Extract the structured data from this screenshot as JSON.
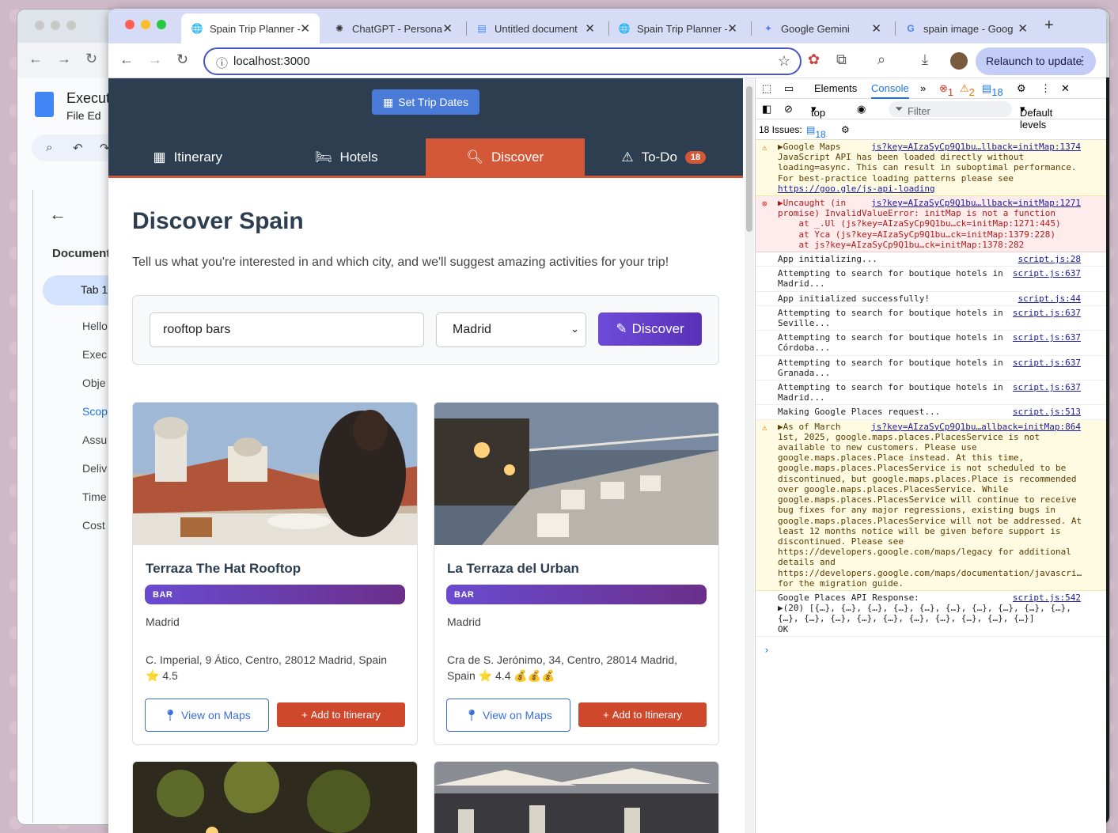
{
  "back_window": {
    "doc_title": "Execut",
    "menu": "File   Ed",
    "outline_heading": "Document",
    "outline_tab": "Tab 1",
    "outline_items": [
      "Hello",
      "Exec",
      "Obje",
      "Scop",
      "Assu",
      "Deliv",
      "Time",
      "Cost"
    ]
  },
  "browser": {
    "tabs": [
      {
        "title": "Spain Trip Planner -",
        "icon": "globe-icon",
        "active": true
      },
      {
        "title": "ChatGPT - Persona",
        "icon": "chatgpt-icon",
        "active": false
      },
      {
        "title": "Untitled document",
        "icon": "docs-icon",
        "active": false
      },
      {
        "title": "Spain Trip Planner -",
        "icon": "globe-icon",
        "active": false
      },
      {
        "title": "Google Gemini",
        "icon": "gemini-icon",
        "active": false
      },
      {
        "title": "spain image - Goog",
        "icon": "google-icon",
        "active": false
      }
    ],
    "url": "localhost:3000",
    "relaunch": "Relaunch to update"
  },
  "app": {
    "trip_dates": "Set Trip Dates",
    "nav": [
      {
        "label": "Itinerary",
        "icon": "calendar-icon"
      },
      {
        "label": "Hotels",
        "icon": "bed-icon"
      },
      {
        "label": "Discover",
        "icon": "search-icon"
      },
      {
        "label": "To-Do",
        "icon": "warning-icon",
        "badge": "18"
      }
    ],
    "title": "Discover Spain",
    "lead": "Tell us what you're interested in and which city, and we'll suggest amazing activities for your trip!",
    "search": {
      "value": "rooftop bars",
      "city": "Madrid",
      "button": "Discover"
    },
    "cards": [
      {
        "title": "Terraza The Hat Rooftop",
        "badge": "BAR",
        "city": "Madrid",
        "address": "C. Imperial, 9 Ático, Centro, 28012 Madrid, Spain",
        "rating": "⭐ 4.5",
        "view": "View on Maps",
        "add": "Add to Itinerary"
      },
      {
        "title": "La Terraza del Urban",
        "badge": "BAR",
        "city": "Madrid",
        "address": "Cra de S. Jerónimo, 34, Centro, 28014 Madrid, Spain",
        "rating": "⭐ 4.4 💰💰💰",
        "view": "View on Maps",
        "add": "Add to Itinerary"
      }
    ]
  },
  "devtools": {
    "tabs": {
      "elements": "Elements",
      "console": "Console",
      "more": "»"
    },
    "counts": {
      "errors": "1",
      "warnings": "2",
      "messages": "18"
    },
    "context": "top",
    "filter": "Filter",
    "levels": "Default levels",
    "issues": "18 Issues:",
    "issues_count": "18",
    "logs": [
      {
        "type": "warn",
        "src": "js?key=AIzaSyCp9Q1bu…llback=initMap:1374",
        "text": "▶Google Maps\nJavaScript API has been loaded directly without\nloading=async. This can result in suboptimal performance.\nFor best-practice loading patterns please see",
        "link": "https://goo.gle/js-api-loading"
      },
      {
        "type": "err",
        "src": "js?key=AIzaSyCp9Q1bu…llback=initMap:1271",
        "text": "▶Uncaught (in\npromise) InvalidValueError: initMap is not a function\n    at _.Ul (js?key=AIzaSyCp9Q1bu…ck=initMap:1271:445)\n    at Yca (js?key=AIzaSyCp9Q1bu…ck=initMap:1379:228)\n    at js?key=AIzaSyCp9Q1bu…ck=initMap:1378:282"
      },
      {
        "type": "log",
        "src": "script.js:28",
        "text": "App initializing..."
      },
      {
        "type": "log",
        "src": "script.js:637",
        "text": "Attempting to search for boutique hotels in\nMadrid..."
      },
      {
        "type": "log",
        "src": "script.js:44",
        "text": "App initialized successfully!"
      },
      {
        "type": "log",
        "src": "script.js:637",
        "text": "Attempting to search for boutique hotels in\nSeville..."
      },
      {
        "type": "log",
        "src": "script.js:637",
        "text": "Attempting to search for boutique hotels in\nCórdoba..."
      },
      {
        "type": "log",
        "src": "script.js:637",
        "text": "Attempting to search for boutique hotels in\nGranada..."
      },
      {
        "type": "log",
        "src": "script.js:637",
        "text": "Attempting to search for boutique hotels in\nMadrid..."
      },
      {
        "type": "log",
        "src": "script.js:513",
        "text": "Making Google Places request..."
      },
      {
        "type": "warn",
        "src": "js?key=AIzaSyCp9Q1bu…allback=initMap:864",
        "text": "▶As of March\n1st, 2025, google.maps.places.PlacesService is not\navailable to new customers. Please use\ngoogle.maps.places.Place instead. At this time,\ngoogle.maps.places.PlacesService is not scheduled to be\ndiscontinued, but google.maps.places.Place is recommended\nover google.maps.places.PlacesService. While\ngoogle.maps.places.PlacesService will continue to receive\nbug fixes for any major regressions, existing bugs in\ngoogle.maps.places.PlacesService will not be addressed. At\nleast 12 months notice will be given before support is\ndiscontinued. Please see\nhttps://developers.google.com/maps/legacy for additional\ndetails and\nhttps://developers.google.com/maps/documentation/javascri…\nfor the migration guide."
      },
      {
        "type": "log",
        "src": "script.js:542",
        "text": "Google Places API Response:\n▶(20) [{…}, {…}, {…}, {…}, {…}, {…}, {…}, {…}, {…}, {…},\n{…}, {…}, {…}, {…}, {…}, {…}, {…}, {…}, {…}, {…}]\nOK"
      }
    ],
    "prompt": "›"
  },
  "colors": {
    "header": "#2c3e50",
    "accent": "#d35838",
    "discover_btn": "#6a3fcf",
    "link": "#3a6fd8"
  }
}
